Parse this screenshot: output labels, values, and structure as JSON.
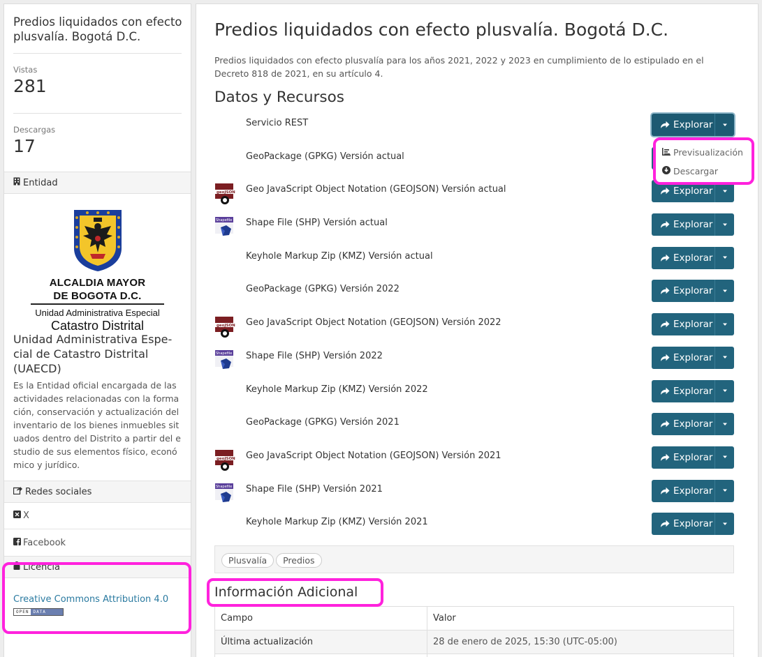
{
  "sidebar": {
    "title": "Predios liquidados con efecto plusvalía. Bogotá D.C.",
    "views_label": "Vistas",
    "views_value": "281",
    "downloads_label": "Descargas",
    "downloads_value": "17",
    "entity_label": "Entidad",
    "logo": {
      "line1": "ALCALDIA MAYOR",
      "line2": "DE BOGOTA D.C.",
      "line3": "Unidad Administrativa Especial",
      "line4": "Catastro Distrital"
    },
    "entity_name": "Unidad Administrativa Espe-cial de Catastro Distrital (UAECD)",
    "entity_description": "Es la Entidad oficial encargada de las actividades relacionadas con la formación, conservación y actualización del inventario de los bienes inmuebles situados dentro del Distrito a partir del estudio de sus elementos físico, económico y jurídico.",
    "social_label": "Redes sociales",
    "social_x": "X",
    "social_facebook": "Facebook",
    "license_label": "Licencia",
    "license_link": "Creative Commons Attribution 4.0",
    "badge_left": "OPEN",
    "badge_right": "DATA"
  },
  "main": {
    "title": "Predios liquidados con efecto plusvalía. Bogotá D.C.",
    "description": "Predios liquidados con efecto plusvalía para los años 2021, 2022 y 2023 en cumplimiento de lo estipulado en el Decreto 818 de 2021, en su artículo 4.",
    "resources_title": "Datos y Recursos",
    "explore_label": "Explorar",
    "resources": [
      {
        "name": "Servicio REST",
        "icon": "none"
      },
      {
        "name": "GeoPackage (GPKG) Versión actual",
        "icon": "none"
      },
      {
        "name": "Geo JavaScript Object Notation (GEOJSON) Versión actual",
        "icon": "geojson-icon"
      },
      {
        "name": "Shape File (SHP) Versión actual",
        "icon": "shapefile-icon"
      },
      {
        "name": "Keyhole Markup Zip (KMZ) Versión actual",
        "icon": "none"
      },
      {
        "name": "GeoPackage (GPKG) Versión 2022",
        "icon": "none"
      },
      {
        "name": "Geo JavaScript Object Notation (GEOJSON) Versión 2022",
        "icon": "geojson-icon"
      },
      {
        "name": "Shape File (SHP) Versión 2022",
        "icon": "shapefile-icon"
      },
      {
        "name": "Keyhole Markup Zip (KMZ) Versión 2022",
        "icon": "none"
      },
      {
        "name": "GeoPackage (GPKG) Versión 2021",
        "icon": "none"
      },
      {
        "name": "Geo JavaScript Object Notation (GEOJSON) Versión 2021",
        "icon": "geojson-icon"
      },
      {
        "name": "Shape File (SHP) Versión 2021",
        "icon": "shapefile-icon"
      },
      {
        "name": "Keyhole Markup Zip (KMZ) Versión 2021",
        "icon": "none"
      }
    ],
    "geojson_icon_text": "geoJSON",
    "shapefile_icon_text": "Shapefile",
    "dropdown": {
      "preview": "Previsualización",
      "download": "Descargar"
    },
    "tags": [
      "Plusvalía",
      "Predios"
    ],
    "info_title": "Información Adicional",
    "table": {
      "header": [
        "Campo",
        "Valor"
      ],
      "rows": [
        [
          "Última actualización",
          "28 de enero de 2025, 15:30 (UTC-05:00)"
        ]
      ]
    }
  }
}
